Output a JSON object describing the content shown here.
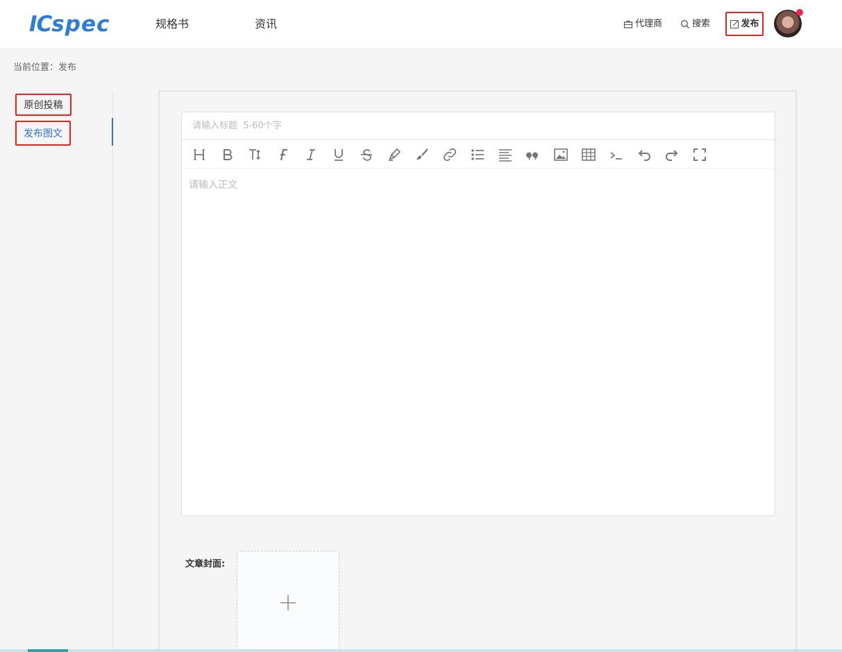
{
  "header": {
    "logo": {
      "part1": "IC",
      "part2": "spec"
    },
    "nav": [
      {
        "label": "规格书"
      },
      {
        "label": "资讯"
      }
    ],
    "agent_label": "代理商",
    "search_label": "搜索",
    "publish_label": "发布"
  },
  "breadcrumb": "当前位置：发布",
  "sidebar": {
    "items": [
      {
        "label": "原创投稿"
      },
      {
        "label": "发布图文"
      }
    ]
  },
  "editor": {
    "title_placeholder": "请输入标题  5-60个字",
    "body_placeholder": "请输入正文",
    "toolbar": [
      "heading-icon",
      "bold-icon",
      "text-size-icon",
      "font-icon",
      "italic-icon",
      "underline-icon",
      "strikethrough-icon",
      "highlighter-icon",
      "brush-icon",
      "link-icon",
      "list-icon",
      "align-icon",
      "quote-icon",
      "image-icon",
      "table-icon",
      "code-icon",
      "undo-icon",
      "redo-icon",
      "fullscreen-icon"
    ]
  },
  "cover": {
    "label": "文章封面:"
  },
  "colors": {
    "brand": "#2f7cd8",
    "highlight_border": "#e8231c",
    "active": "#2f72d8"
  }
}
